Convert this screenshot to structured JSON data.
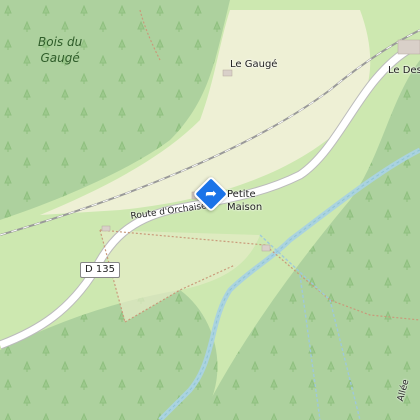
{
  "map": {
    "forest_label_line1": "Bois du",
    "forest_label_line2": "Gaugé",
    "hamlet_label": "Le Gaugé",
    "hamlet2_label": "Le Des",
    "place_label_line1": "Petite",
    "place_label_line2": "Maison",
    "road_label": "Route d'Orchaise",
    "road_number": "D 135",
    "path_label": "Allée",
    "pin_icon": "directions-icon",
    "colors": {
      "forest": "#add19e",
      "meadow": "#cde8b0",
      "farmland": "#eef0d5",
      "water": "#aad3df",
      "road": "#ffffff",
      "road_casing": "#bbbbbb",
      "pin": "#1a73e8"
    }
  }
}
